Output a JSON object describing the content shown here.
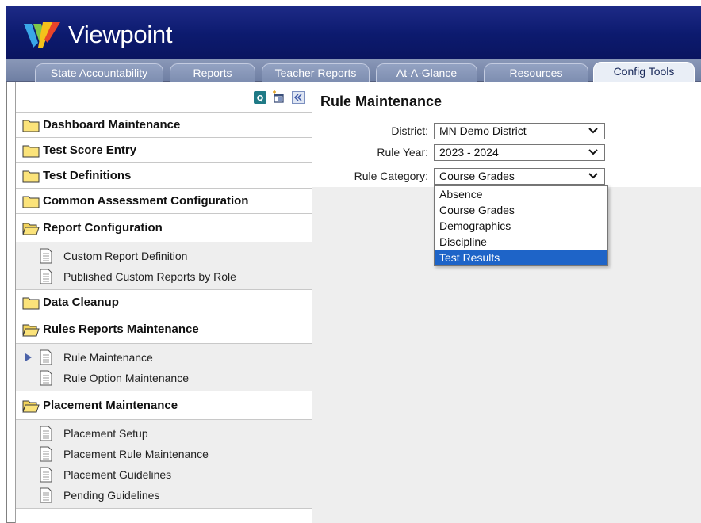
{
  "app": {
    "logo_text": "Viewpoint"
  },
  "tabs": [
    {
      "label": "State Accountability"
    },
    {
      "label": "Reports"
    },
    {
      "label": "Teacher Reports"
    },
    {
      "label": "At-A-Glance"
    },
    {
      "label": "Resources"
    },
    {
      "label": "Config Tools",
      "active": true
    }
  ],
  "sidebar": {
    "folders": [
      {
        "label": "Dashboard Maintenance",
        "open": false,
        "children": []
      },
      {
        "label": "Test Score Entry",
        "open": false,
        "children": []
      },
      {
        "label": "Test Definitions",
        "open": false,
        "children": []
      },
      {
        "label": "Common Assessment Configuration",
        "open": false,
        "children": []
      },
      {
        "label": "Report Configuration",
        "open": true,
        "children": [
          {
            "label": "Custom Report Definition"
          },
          {
            "label": "Published Custom Reports by Role"
          }
        ]
      },
      {
        "label": "Data Cleanup",
        "open": false,
        "children": []
      },
      {
        "label": "Rules Reports Maintenance",
        "open": true,
        "children": [
          {
            "label": "Rule Maintenance",
            "selected": true
          },
          {
            "label": "Rule Option Maintenance"
          }
        ]
      },
      {
        "label": "Placement Maintenance",
        "open": true,
        "children": [
          {
            "label": "Placement Setup"
          },
          {
            "label": "Placement Rule Maintenance"
          },
          {
            "label": "Placement Guidelines"
          },
          {
            "label": "Pending Guidelines"
          }
        ]
      }
    ]
  },
  "main": {
    "title": "Rule Maintenance",
    "district": {
      "label": "District:",
      "value": "MN Demo District"
    },
    "rule_year": {
      "label": "Rule Year:",
      "value": "2023 - 2024"
    },
    "rule_category": {
      "label": "Rule Category:",
      "value": "Course Grades",
      "options": [
        "Absence",
        "Course Grades",
        "Demographics",
        "Discipline",
        "Test Results"
      ],
      "highlighted": "Test Results"
    }
  },
  "colors": {
    "banner": "#0c1a6e",
    "tab_strip": "#7d8db0",
    "highlight": "#1e64c8"
  }
}
